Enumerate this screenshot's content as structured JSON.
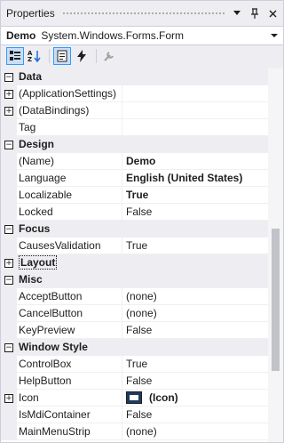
{
  "window": {
    "title": "Properties"
  },
  "object_selector": {
    "name": "Demo",
    "type": "System.Windows.Forms.Form"
  },
  "toolbar": {
    "buttons": [
      "categorized-icon",
      "alphabetical-icon",
      "properties-icon",
      "events-icon",
      "property-pages-icon"
    ]
  },
  "grid": {
    "rows": [
      {
        "kind": "cat",
        "label": "Data",
        "expander": "−"
      },
      {
        "kind": "prop",
        "label": "(ApplicationSettings)",
        "value": "",
        "expander": "+"
      },
      {
        "kind": "prop",
        "label": "(DataBindings)",
        "value": "",
        "expander": "+"
      },
      {
        "kind": "prop",
        "label": "Tag",
        "value": ""
      },
      {
        "kind": "cat",
        "label": "Design",
        "expander": "−"
      },
      {
        "kind": "prop",
        "label": "(Name)",
        "value": "Demo",
        "bold": true
      },
      {
        "kind": "prop",
        "label": "Language",
        "value": "English (United States)",
        "bold": true
      },
      {
        "kind": "prop",
        "label": "Localizable",
        "value": "True",
        "bold": true
      },
      {
        "kind": "prop",
        "label": "Locked",
        "value": "False"
      },
      {
        "kind": "cat",
        "label": "Focus",
        "expander": "−"
      },
      {
        "kind": "prop",
        "label": "CausesValidation",
        "value": "True"
      },
      {
        "kind": "cat",
        "label": "Layout",
        "expander": "+"
      },
      {
        "kind": "cat",
        "label": "Misc",
        "expander": "−"
      },
      {
        "kind": "prop",
        "label": "AcceptButton",
        "value": "(none)"
      },
      {
        "kind": "prop",
        "label": "CancelButton",
        "value": "(none)"
      },
      {
        "kind": "prop",
        "label": "KeyPreview",
        "value": "False"
      },
      {
        "kind": "cat",
        "label": "Window Style",
        "expander": "−"
      },
      {
        "kind": "prop",
        "label": "ControlBox",
        "value": "True"
      },
      {
        "kind": "prop",
        "label": "HelpButton",
        "value": "False"
      },
      {
        "kind": "prop",
        "label": "Icon",
        "value": "(Icon)",
        "bold": true,
        "expander": "+",
        "swatch": true
      },
      {
        "kind": "prop",
        "label": "IsMdiContainer",
        "value": "False"
      },
      {
        "kind": "prop",
        "label": "MainMenuStrip",
        "value": "(none)"
      }
    ]
  },
  "colors": {
    "accent": "#3399ff",
    "panel": "#eeeef2",
    "icon_swatch": "#1e3a5f"
  }
}
